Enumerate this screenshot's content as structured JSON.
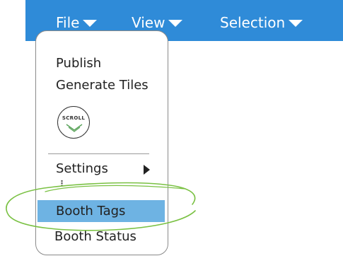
{
  "menubar": {
    "accent_color": "#2f8bd8",
    "menus": [
      {
        "label": "File",
        "icon": "caret-down-icon"
      },
      {
        "label": "View",
        "icon": "caret-down-icon"
      },
      {
        "label": "Selection",
        "icon": "caret-down-icon"
      }
    ]
  },
  "file_menu": {
    "items": {
      "publish": "Publish",
      "generate_tiles": "Generate Tiles",
      "scroll_logo_text": "SCROLL",
      "settings": "Settings",
      "ellipsis": "⋮",
      "booth_tags": "Booth Tags",
      "booth_status": "Booth Status"
    },
    "selected_item": "Booth Tags",
    "highlight_color": "#6eb3e3",
    "annotation_color": "#7ac143"
  }
}
